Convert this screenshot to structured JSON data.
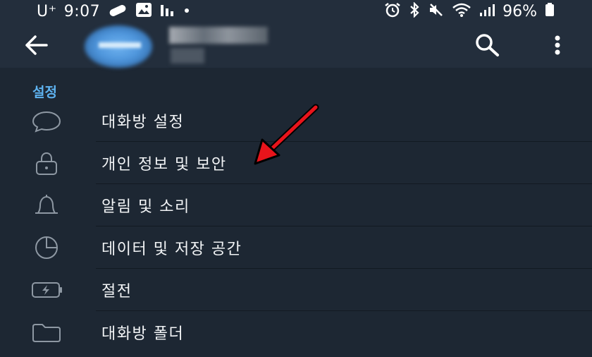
{
  "status_bar": {
    "carrier": "U⁺",
    "time": "9:07",
    "battery_text": "96%"
  },
  "header": {
    "back_icon": "arrow-left-icon",
    "search_icon": "search-icon",
    "more_icon": "more-vertical-icon"
  },
  "section": {
    "title": "설정"
  },
  "menu": {
    "items": [
      {
        "label": "대화방 설정",
        "icon": "chat-bubble-icon"
      },
      {
        "label": "개인 정보 및 보안",
        "icon": "lock-icon"
      },
      {
        "label": "알림 및 소리",
        "icon": "bell-icon"
      },
      {
        "label": "데이터 및 저장 공간",
        "icon": "pie-chart-icon"
      },
      {
        "label": "절전",
        "icon": "battery-icon"
      },
      {
        "label": "대화방 폴더",
        "icon": "folder-icon"
      }
    ]
  },
  "annotation": {
    "color": "#e8141b"
  }
}
